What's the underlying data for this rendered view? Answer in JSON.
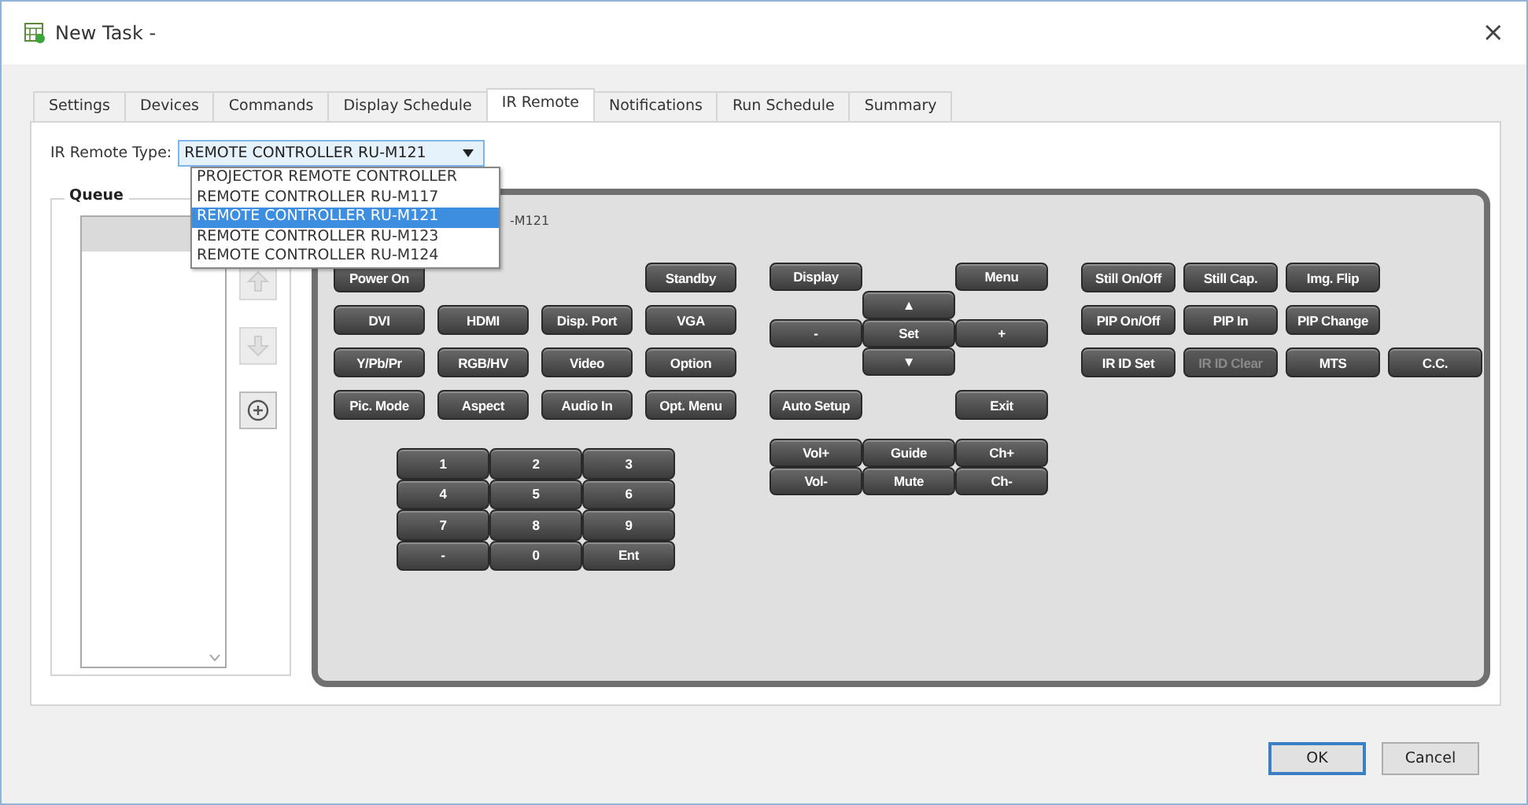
{
  "window": {
    "title": "New Task -",
    "close": "×"
  },
  "tabs": [
    {
      "label": "Settings",
      "selected": false
    },
    {
      "label": "Devices",
      "selected": false
    },
    {
      "label": "Commands",
      "selected": false
    },
    {
      "label": "Display Schedule",
      "selected": false
    },
    {
      "label": "IR Remote",
      "selected": true
    },
    {
      "label": "Notifications",
      "selected": false
    },
    {
      "label": "Run Schedule",
      "selected": false
    },
    {
      "label": "Summary",
      "selected": false
    }
  ],
  "remote_type": {
    "label": "IR Remote Type:",
    "value": "REMOTE CONTROLLER RU-M121",
    "expanded": true,
    "options": [
      {
        "label": "PROJECTOR REMOTE CONTROLLER",
        "selected": false
      },
      {
        "label": "REMOTE CONTROLLER RU-M117",
        "selected": false
      },
      {
        "label": "REMOTE CONTROLLER RU-M121",
        "selected": true
      },
      {
        "label": "REMOTE CONTROLLER RU-M123",
        "selected": false
      },
      {
        "label": "REMOTE CONTROLLER RU-M124",
        "selected": false
      }
    ]
  },
  "queue": {
    "title": "Queue",
    "rows": [
      {
        "selected": true
      }
    ],
    "buttons": [
      {
        "kind": "up",
        "disabled": true
      },
      {
        "kind": "down",
        "disabled": true
      },
      {
        "kind": "add",
        "disabled": false
      }
    ]
  },
  "remote": {
    "title": "-M121",
    "groups": [
      {
        "kind": "inputs",
        "buttons": [
          {
            "label": "Power On",
            "disabled": false
          },
          {
            "label": "Standby",
            "disabled": false
          },
          {
            "label": "DVI",
            "disabled": false
          },
          {
            "label": "HDMI",
            "disabled": false
          },
          {
            "label": "Disp. Port",
            "disabled": false
          },
          {
            "label": "VGA",
            "disabled": false
          },
          {
            "label": "Y/Pb/Pr",
            "disabled": false
          },
          {
            "label": "RGB/HV",
            "disabled": false
          },
          {
            "label": "Video",
            "disabled": false
          },
          {
            "label": "Option",
            "disabled": false
          },
          {
            "label": "Pic. Mode",
            "disabled": false
          },
          {
            "label": "Aspect",
            "disabled": false
          },
          {
            "label": "Audio In",
            "disabled": false
          },
          {
            "label": "Opt. Menu",
            "disabled": false
          }
        ]
      },
      {
        "kind": "numpad",
        "buttons": [
          {
            "label": "1",
            "disabled": false
          },
          {
            "label": "2",
            "disabled": false
          },
          {
            "label": "3",
            "disabled": false
          },
          {
            "label": "4",
            "disabled": false
          },
          {
            "label": "5",
            "disabled": false
          },
          {
            "label": "6",
            "disabled": false
          },
          {
            "label": "7",
            "disabled": false
          },
          {
            "label": "8",
            "disabled": false
          },
          {
            "label": "9",
            "disabled": false
          },
          {
            "label": "-",
            "disabled": false
          },
          {
            "label": "0",
            "disabled": false
          },
          {
            "label": "Ent",
            "disabled": false
          }
        ]
      },
      {
        "kind": "nav",
        "buttons": [
          {
            "label": "Display",
            "disabled": false
          },
          {
            "label": "Menu",
            "disabled": false
          },
          {
            "label": "▲",
            "disabled": false
          },
          {
            "label": "-",
            "disabled": false
          },
          {
            "label": "Set",
            "disabled": false
          },
          {
            "label": "+",
            "disabled": false
          },
          {
            "label": "▼",
            "disabled": false
          },
          {
            "label": "Auto Setup",
            "disabled": false
          },
          {
            "label": "Exit",
            "disabled": false
          }
        ]
      },
      {
        "kind": "media",
        "buttons": [
          {
            "label": "Vol+",
            "disabled": false
          },
          {
            "label": "Guide",
            "disabled": false
          },
          {
            "label": "Ch+",
            "disabled": false
          },
          {
            "label": "Vol-",
            "disabled": false
          },
          {
            "label": "Mute",
            "disabled": false
          },
          {
            "label": "Ch-",
            "disabled": false
          }
        ]
      },
      {
        "kind": "features",
        "buttons": [
          {
            "label": "Still On/Off",
            "disabled": false
          },
          {
            "label": "Still Cap.",
            "disabled": false
          },
          {
            "label": "Img. Flip",
            "disabled": false
          },
          {
            "label": "PIP On/Off",
            "disabled": false
          },
          {
            "label": "PIP In",
            "disabled": false
          },
          {
            "label": "PIP Change",
            "disabled": false
          },
          {
            "label": "IR ID Set",
            "disabled": false
          },
          {
            "label": "IR ID Clear",
            "disabled": true
          },
          {
            "label": "MTS",
            "disabled": false
          },
          {
            "label": "C.C.",
            "disabled": false
          }
        ]
      }
    ]
  },
  "footer": {
    "buttons": [
      {
        "label": "OK",
        "kind": "default"
      },
      {
        "label": "Cancel",
        "kind": "normal"
      }
    ]
  }
}
